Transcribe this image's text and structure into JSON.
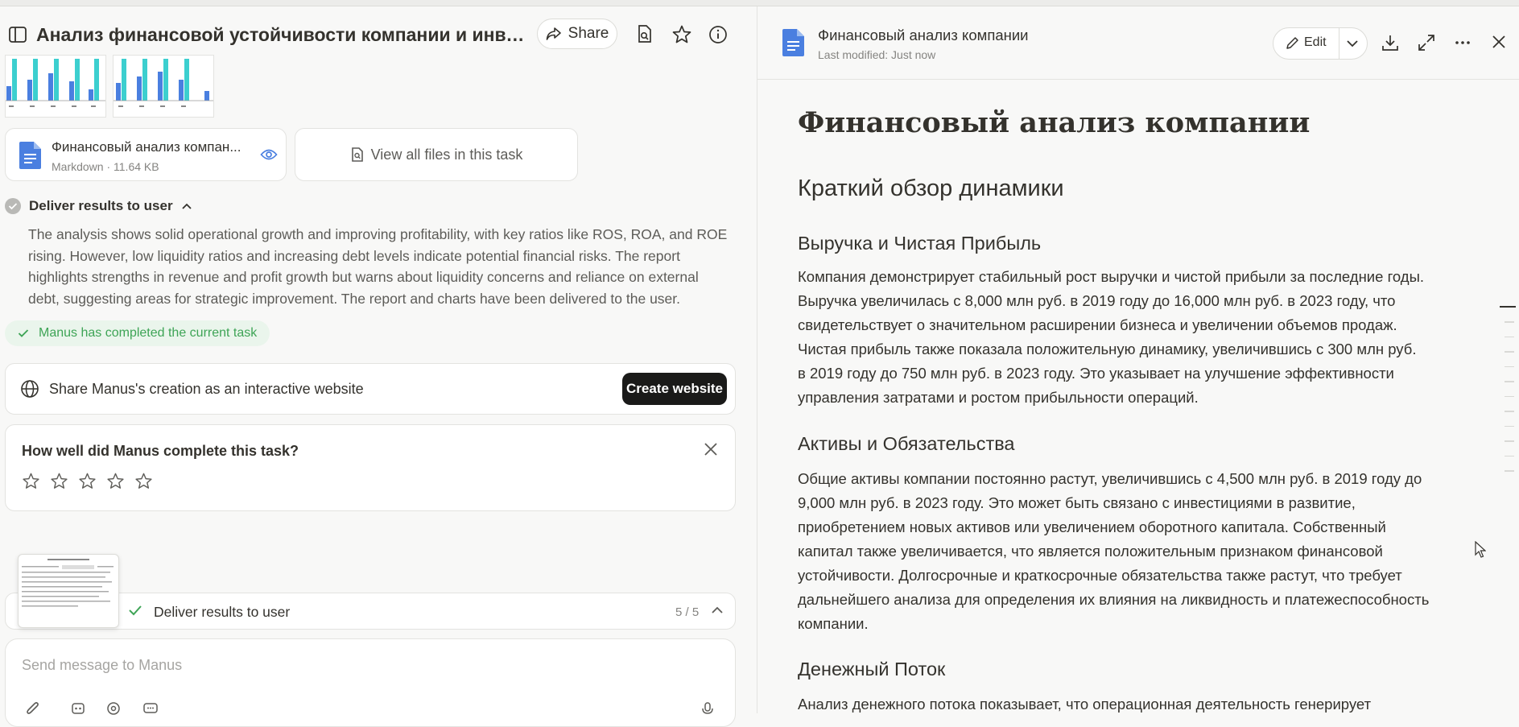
{
  "header": {
    "title": "Анализ финансовой устойчивости компании и инвести...",
    "share_label": "Share"
  },
  "attachment": {
    "name": "Финансовый анализ компан...",
    "meta": "Markdown · 11.64 KB"
  },
  "view_all_label": "View all files in this task",
  "deliver": {
    "heading": "Deliver results to user",
    "text": "The analysis shows solid operational growth and improving profitability, with key ratios like ROS, ROA, and ROE rising. However, low liquidity ratios and increasing debt levels indicate potential financial risks. The report highlights strengths in revenue and profit growth but warns about liquidity concerns and reliance on external debt, suggesting areas for strategic improvement. The report and charts have been delivered to the user."
  },
  "completed_label": "Manus has completed the current task",
  "share_website": {
    "text": "Share Manus's creation as an interactive website",
    "button": "Create website"
  },
  "rating": {
    "question": "How well did Manus complete this task?",
    "stars": 5
  },
  "step_bar": {
    "label": "Deliver results to user",
    "count": "5 / 5"
  },
  "message_input": {
    "placeholder": "Send message to Manus"
  },
  "preview": {
    "title": "Финансовый анализ компании",
    "modified": "Last modified: Just now",
    "edit_label": "Edit"
  },
  "document": {
    "h1": "Финансовый анализ компании",
    "h2": "Краткий обзор динамики",
    "sections": [
      {
        "heading": "Выручка и Чистая Прибыль",
        "lines": [
          "Компания демонстрирует стабильный рост выручки и чистой прибыли за последние годы.",
          "Выручка увеличилась с 8,000 млн руб. в 2019 году до 16,000 млн руб. в 2023 году, что",
          "свидетельствует о значительном расширении бизнеса и увеличении объемов продаж.",
          "Чистая прибыль также показала положительную динамику, увеличившись с 300 млн руб.",
          "в 2019 году до 750 млн руб. в 2023 году. Это указывает на улучшение эффективности",
          "управления затратами и ростом прибыльности операций."
        ]
      },
      {
        "heading": "Активы и Обязательства",
        "lines": [
          "Общие активы компании постоянно растут, увеличившись с 4,500 млн руб. в 2019 году до",
          "9,000 млн руб. в 2023 году. Это может быть связано с инвестициями в развитие,",
          "приобретением новых активов или увеличением оборотного капитала. Собственный",
          "капитал также увеличивается, что является положительным признаком финансовой",
          "устойчивости. Долгосрочные и краткосрочные обязательства также растут, что требует",
          "дальнейшего анализа для определения их влияния на ликвидность и платежеспособность",
          "компании."
        ]
      },
      {
        "heading": "Денежный Поток",
        "lines": [
          "Анализ денежного потока показывает, что операционная деятельность генерирует"
        ]
      }
    ]
  },
  "colors": {
    "accent_blue": "#4a7fe0",
    "success_green": "#3ea456",
    "dark_button": "#1a1a19"
  }
}
